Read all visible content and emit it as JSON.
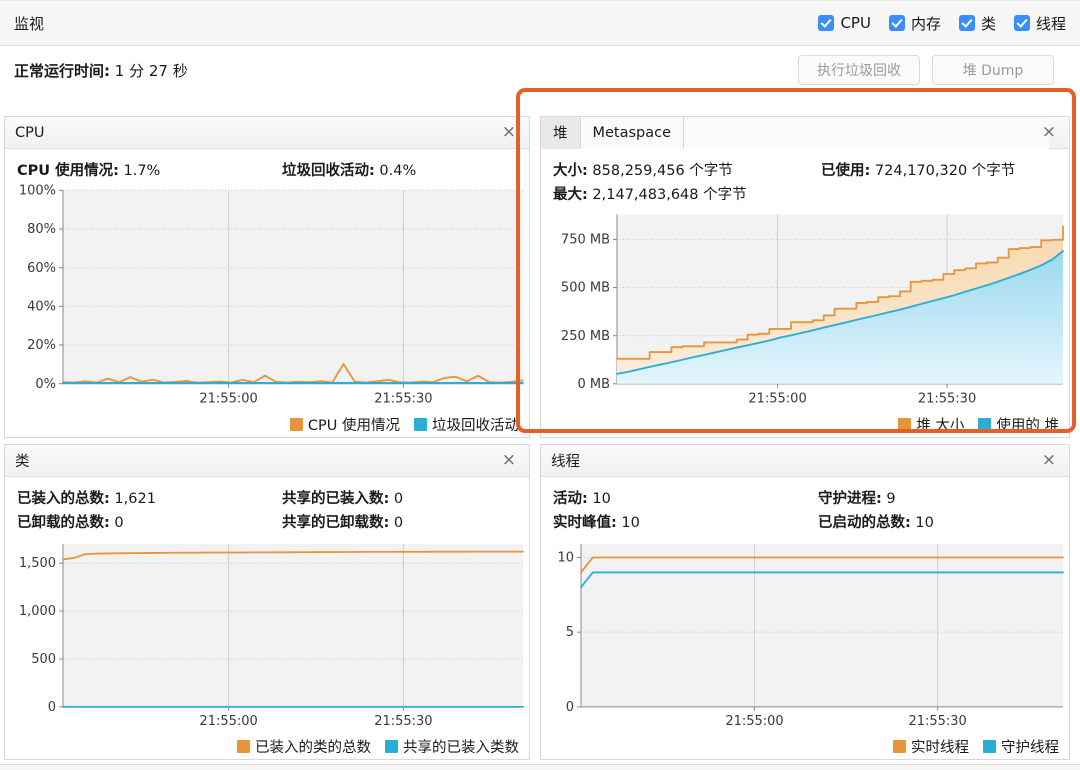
{
  "header": {
    "title": "监视",
    "toggles": [
      {
        "label": "CPU",
        "checked": true
      },
      {
        "label": "内存",
        "checked": true
      },
      {
        "label": "类",
        "checked": true
      },
      {
        "label": "线程",
        "checked": true
      }
    ]
  },
  "uptime": {
    "label": "正常运行时间:",
    "value": "1 分 27 秒"
  },
  "actions": {
    "gc_label": "执行垃圾回收",
    "heapdump_label": "堆 Dump"
  },
  "colors": {
    "series_orange": "#e8943a",
    "series_blue": "#2aaed6",
    "highlight": "#e4602a",
    "checkbox": "#3a8dfd"
  },
  "panels": {
    "cpu": {
      "title": "CPU",
      "close_label": "×",
      "stats": [
        {
          "label": "CPU 使用情况:",
          "value": "1.7%"
        },
        {
          "label": "垃圾回收活动:",
          "value": "0.4%"
        }
      ],
      "legend": [
        {
          "label": "CPU 使用情况",
          "color": "#e8943a"
        },
        {
          "label": "垃圾回收活动",
          "color": "#2aaed6"
        }
      ]
    },
    "memory": {
      "tabs": [
        {
          "label": "堆",
          "active": true
        },
        {
          "label": "Metaspace",
          "active": false
        }
      ],
      "close_label": "×",
      "stats": [
        {
          "label": "大小:",
          "value": "858,259,456 个字节"
        },
        {
          "label": "已使用:",
          "value": "724,170,320 个字节"
        },
        {
          "label": "最大:",
          "value": "2,147,483,648 个字节"
        }
      ],
      "legend": [
        {
          "label": "堆 大小",
          "color": "#e8943a"
        },
        {
          "label": "使用的 堆",
          "color": "#2aaed6"
        }
      ]
    },
    "classes": {
      "title": "类",
      "close_label": "×",
      "stats": [
        {
          "label": "已装入的总数:",
          "value": "1,621"
        },
        {
          "label": "共享的已装入数:",
          "value": "0"
        },
        {
          "label": "已卸载的总数:",
          "value": "0"
        },
        {
          "label": "共享的已卸载数:",
          "value": "0"
        }
      ],
      "legend": [
        {
          "label": "已装入的类的总数",
          "color": "#e8943a"
        },
        {
          "label": "共享的已装入类数",
          "color": "#2aaed6"
        }
      ]
    },
    "threads": {
      "title": "线程",
      "close_label": "×",
      "stats": [
        {
          "label": "活动:",
          "value": "10"
        },
        {
          "label": "守护进程:",
          "value": "9"
        },
        {
          "label": "实时峰值:",
          "value": "10"
        },
        {
          "label": "已启动的总数:",
          "value": "10"
        }
      ],
      "legend": [
        {
          "label": "实时线程",
          "color": "#e8943a"
        },
        {
          "label": "守护线程",
          "color": "#2aaed6"
        }
      ]
    }
  },
  "chart_data": [
    {
      "id": "cpu",
      "type": "line",
      "title": "CPU",
      "xlabel": "",
      "ylabel": "",
      "ylim": [
        0,
        100
      ],
      "yticks": [
        0,
        20,
        40,
        60,
        80,
        100
      ],
      "ytick_labels": [
        "0%",
        "20%",
        "40%",
        "60%",
        "80%",
        "100%"
      ],
      "xticks": [
        "21:55:00",
        "21:55:30"
      ],
      "xtick_positions": [
        0.36,
        0.74
      ],
      "grid": true,
      "legend_position": "bottom-right",
      "series": [
        {
          "name": "CPU 使用情况",
          "color": "#e8943a",
          "values": [
            0.8,
            0.6,
            1.2,
            0.5,
            2.6,
            0.7,
            3.4,
            1.0,
            2.1,
            0.6,
            0.9,
            1.4,
            0.5,
            0.8,
            1.1,
            0.6,
            2.0,
            0.7,
            4.2,
            0.9,
            0.6,
            1.0,
            0.7,
            1.3,
            0.6,
            10.2,
            1.0,
            0.6,
            1.2,
            2.0,
            0.7,
            0.6,
            1.1,
            0.8,
            3.0,
            3.6,
            1.2,
            4.1,
            0.8,
            0.6,
            0.9,
            1.7
          ]
        },
        {
          "name": "垃圾回收活动",
          "color": "#2aaed6",
          "values": [
            0.4,
            0.4,
            0.4,
            0.4,
            0.4,
            0.4,
            0.4,
            0.4,
            0.4,
            0.4,
            0.4,
            0.4,
            0.4,
            0.4,
            0.4,
            0.4,
            0.4,
            0.4,
            0.4,
            0.4,
            0.4,
            0.4,
            0.4,
            0.4,
            0.4,
            0.4,
            0.4,
            0.4,
            0.4,
            0.4,
            0.4,
            0.4,
            0.4,
            0.4,
            0.4,
            0.4,
            0.4,
            0.4,
            0.4,
            0.4,
            0.4,
            0.4
          ]
        }
      ]
    },
    {
      "id": "memory",
      "type": "area",
      "title": "堆",
      "xlabel": "",
      "ylabel": "",
      "ylim": [
        0,
        880
      ],
      "yticks": [
        0,
        250,
        500,
        750
      ],
      "ytick_labels": [
        "0 MB",
        "250 MB",
        "500 MB",
        "750 MB"
      ],
      "xticks": [
        "21:55:00",
        "21:55:30"
      ],
      "xtick_positions": [
        0.36,
        0.74
      ],
      "grid": true,
      "legend_position": "bottom-right",
      "series": [
        {
          "name": "堆 大小",
          "color": "#e8943a",
          "values": [
            130,
            130,
            130,
            165,
            165,
            190,
            195,
            195,
            215,
            215,
            215,
            230,
            255,
            260,
            285,
            285,
            320,
            320,
            330,
            355,
            390,
            390,
            420,
            425,
            450,
            455,
            480,
            530,
            535,
            540,
            570,
            590,
            600,
            625,
            630,
            655,
            700,
            705,
            710,
            745,
            748,
            818
          ]
        },
        {
          "name": "使用的 堆",
          "color": "#2aaed6",
          "values": [
            52,
            62,
            75,
            88,
            100,
            112,
            125,
            138,
            150,
            163,
            175,
            188,
            200,
            212,
            225,
            240,
            252,
            265,
            278,
            292,
            305,
            318,
            332,
            345,
            358,
            372,
            385,
            400,
            415,
            430,
            445,
            460,
            478,
            495,
            512,
            530,
            550,
            570,
            592,
            615,
            645,
            690
          ]
        }
      ]
    },
    {
      "id": "classes",
      "type": "line",
      "title": "类",
      "xlabel": "",
      "ylabel": "",
      "ylim": [
        0,
        1700
      ],
      "yticks": [
        0,
        500,
        1000,
        1500
      ],
      "ytick_labels": [
        "0",
        "500",
        "1,000",
        "1,500"
      ],
      "xticks": [
        "21:55:00",
        "21:55:30"
      ],
      "xtick_positions": [
        0.36,
        0.74
      ],
      "grid": true,
      "legend_position": "bottom-right",
      "series": [
        {
          "name": "已装入的类的总数",
          "color": "#e8943a",
          "values": [
            1540,
            1555,
            1595,
            1600,
            1602,
            1604,
            1605,
            1606,
            1607,
            1608,
            1609,
            1610,
            1610,
            1611,
            1611,
            1612,
            1612,
            1613,
            1613,
            1614,
            1614,
            1615,
            1615,
            1616,
            1616,
            1617,
            1617,
            1618,
            1618,
            1618,
            1619,
            1619,
            1619,
            1620,
            1620,
            1620,
            1620,
            1621,
            1621,
            1621,
            1621,
            1621
          ]
        },
        {
          "name": "共享的已装入类数",
          "color": "#2aaed6",
          "values": [
            0,
            0,
            0,
            0,
            0,
            0,
            0,
            0,
            0,
            0,
            0,
            0,
            0,
            0,
            0,
            0,
            0,
            0,
            0,
            0,
            0,
            0,
            0,
            0,
            0,
            0,
            0,
            0,
            0,
            0,
            0,
            0,
            0,
            0,
            0,
            0,
            0,
            0,
            0,
            0,
            0,
            0
          ]
        }
      ]
    },
    {
      "id": "threads",
      "type": "line",
      "title": "线程",
      "xlabel": "",
      "ylabel": "",
      "ylim": [
        0,
        10.9
      ],
      "yticks": [
        0,
        5,
        10
      ],
      "ytick_labels": [
        "0",
        "5",
        "10"
      ],
      "xticks": [
        "21:55:00",
        "21:55:30"
      ],
      "xtick_positions": [
        0.36,
        0.74
      ],
      "grid": true,
      "legend_position": "bottom-right",
      "series": [
        {
          "name": "实时线程",
          "color": "#e8943a",
          "values": [
            9,
            10,
            10,
            10,
            10,
            10,
            10,
            10,
            10,
            10,
            10,
            10,
            10,
            10,
            10,
            10,
            10,
            10,
            10,
            10,
            10,
            10,
            10,
            10,
            10,
            10,
            10,
            10,
            10,
            10,
            10,
            10,
            10,
            10,
            10,
            10,
            10,
            10,
            10,
            10,
            10,
            10
          ]
        },
        {
          "name": "守护线程",
          "color": "#2aaed6",
          "values": [
            8,
            9,
            9,
            9,
            9,
            9,
            9,
            9,
            9,
            9,
            9,
            9,
            9,
            9,
            9,
            9,
            9,
            9,
            9,
            9,
            9,
            9,
            9,
            9,
            9,
            9,
            9,
            9,
            9,
            9,
            9,
            9,
            9,
            9,
            9,
            9,
            9,
            9,
            9,
            9,
            9,
            9
          ]
        }
      ]
    }
  ]
}
